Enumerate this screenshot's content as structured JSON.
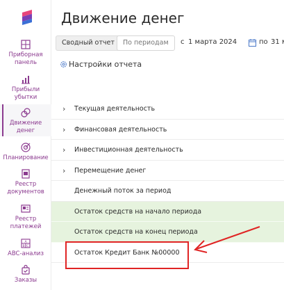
{
  "page": {
    "title": "Движение денег"
  },
  "sidebar": {
    "items": [
      {
        "label": "Приборная\nпанель",
        "icon": "dashboard-icon"
      },
      {
        "label": "Прибыли\nубытки",
        "icon": "chart-icon"
      },
      {
        "label": "Движение\nденег",
        "icon": "money-flow-icon"
      },
      {
        "label": "Планирование",
        "icon": "target-icon"
      },
      {
        "label": "Реестр\nдокументов",
        "icon": "documents-icon"
      },
      {
        "label": "Реестр\nплатежей",
        "icon": "payments-icon"
      },
      {
        "label": "ABC-анализ",
        "icon": "abc-icon"
      },
      {
        "label": "Заказы",
        "icon": "orders-icon"
      }
    ]
  },
  "toolbar": {
    "tab_summary": "Сводный отчет",
    "tab_periods": "По периодам",
    "date_from_label": "с",
    "date_from": "1 марта 2024",
    "date_to_label": "по",
    "date_to": "31 м"
  },
  "settings": {
    "label": "Настройки отчета"
  },
  "report": {
    "rows": [
      {
        "label": "Текущая деятельность",
        "expandable": true
      },
      {
        "label": "Финансовая деятельность",
        "expandable": true
      },
      {
        "label": "Инвестиционная деятельность",
        "expandable": true
      },
      {
        "label": "Перемещение денег",
        "expandable": true
      },
      {
        "label": "Денежный поток за период",
        "expandable": false
      },
      {
        "label": "Остаток средств на начало периода",
        "expandable": false
      },
      {
        "label": "Остаток средств на конец периода",
        "expandable": false
      },
      {
        "label": "Остаток Кредит Банк №00000",
        "expandable": false
      }
    ]
  },
  "colors": {
    "accent": "#8b3a8f",
    "green_row": "#e6f3de",
    "annotation_red": "#e02424"
  }
}
